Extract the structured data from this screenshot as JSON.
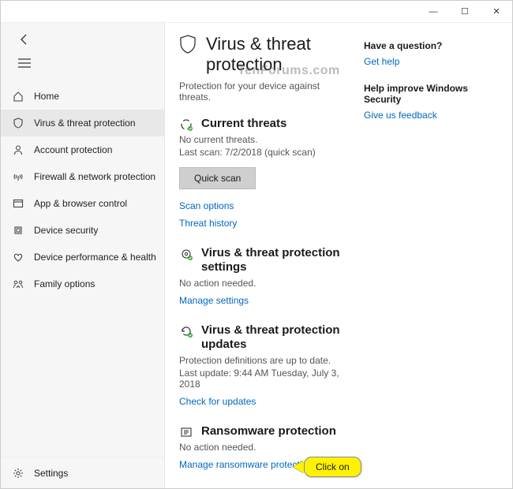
{
  "watermark": "TenForums.com",
  "window": {
    "minimize": "—",
    "maximize": "☐",
    "close": "✕"
  },
  "sidebar": {
    "items": [
      {
        "label": "Home"
      },
      {
        "label": "Virus & threat protection"
      },
      {
        "label": "Account protection"
      },
      {
        "label": "Firewall & network protection"
      },
      {
        "label": "App & browser control"
      },
      {
        "label": "Device security"
      },
      {
        "label": "Device performance & health"
      },
      {
        "label": "Family options"
      }
    ],
    "settings_label": "Settings"
  },
  "page": {
    "title": "Virus & threat protection",
    "subtitle": "Protection for your device against threats."
  },
  "sections": {
    "current": {
      "title": "Current threats",
      "line1": "No current threats.",
      "line2": "Last scan: 7/2/2018 (quick scan)",
      "button": "Quick scan",
      "link1": "Scan options",
      "link2": "Threat history"
    },
    "settings": {
      "title": "Virus & threat protection settings",
      "line1": "No action needed.",
      "link1": "Manage settings"
    },
    "updates": {
      "title": "Virus & threat protection updates",
      "line1": "Protection definitions are up to date.",
      "line2": "Last update: 9:44 AM Tuesday, July 3, 2018",
      "link1": "Check for updates"
    },
    "ransomware": {
      "title": "Ransomware protection",
      "line1": "No action needed.",
      "link1": "Manage ransomware protection"
    }
  },
  "aside": {
    "question_heading": "Have a question?",
    "question_link": "Get help",
    "feedback_heading": "Help improve Windows Security",
    "feedback_link": "Give us feedback"
  },
  "callout": {
    "text": "Click on"
  }
}
